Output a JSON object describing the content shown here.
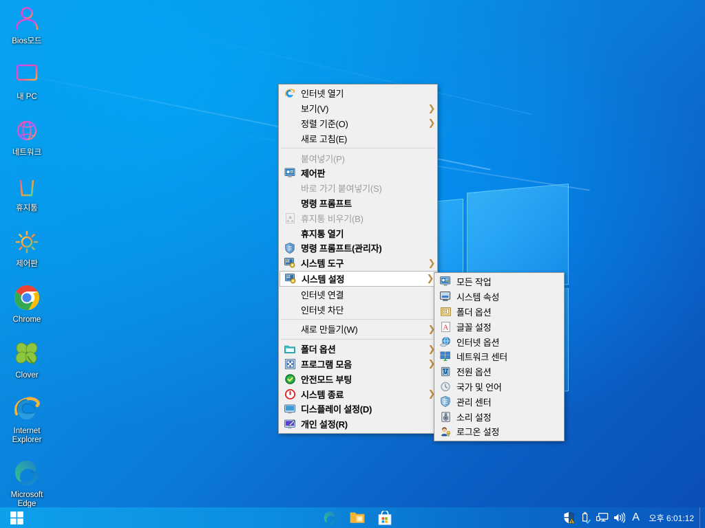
{
  "desktop": {
    "icons": [
      {
        "label": "Bios모드",
        "icon": "person-icon"
      },
      {
        "label": "내 PC",
        "icon": "monitor-icon"
      },
      {
        "label": "네트워크",
        "icon": "globe-icon"
      },
      {
        "label": "휴지통",
        "icon": "recycle-bin-icon"
      },
      {
        "label": "제어판",
        "icon": "gear-icon"
      },
      {
        "label": "Chrome",
        "icon": "chrome-icon"
      },
      {
        "label": "Clover",
        "icon": "clover-icon"
      },
      {
        "label": "Internet Explorer",
        "icon": "internet-explorer-icon"
      },
      {
        "label": "Microsoft Edge",
        "icon": "microsoft-edge-icon"
      }
    ]
  },
  "context_menu": {
    "items": [
      {
        "label": "인터넷 열기",
        "icon": "internet-explorer-icon",
        "bold": false,
        "disabled": false,
        "arrow": false
      },
      {
        "label": "보기(V)",
        "icon": "",
        "bold": false,
        "disabled": false,
        "arrow": true
      },
      {
        "label": "정렬 기준(O)",
        "icon": "",
        "bold": false,
        "disabled": false,
        "arrow": true
      },
      {
        "label": "새로 고침(E)",
        "icon": "",
        "bold": false,
        "disabled": false,
        "arrow": false
      },
      {
        "separator": true
      },
      {
        "label": "붙여넣기(P)",
        "icon": "",
        "bold": false,
        "disabled": true,
        "arrow": false
      },
      {
        "label": "제어판",
        "icon": "control-panel-icon",
        "bold": true,
        "disabled": false,
        "arrow": false
      },
      {
        "label": "바로 가기 붙여넣기(S)",
        "icon": "",
        "bold": false,
        "disabled": true,
        "arrow": false
      },
      {
        "label": "명령 프롬프트",
        "icon": "",
        "bold": true,
        "disabled": false,
        "arrow": false
      },
      {
        "label": "휴지통 비우기(B)",
        "icon": "recycle-bin-icon",
        "bold": false,
        "disabled": true,
        "arrow": false
      },
      {
        "label": "휴지통 열기",
        "icon": "",
        "bold": true,
        "disabled": false,
        "arrow": false
      },
      {
        "label": "명령 프롬프트(관리자)",
        "icon": "shield-icon",
        "bold": true,
        "disabled": false,
        "arrow": false
      },
      {
        "label": "시스템 도구",
        "icon": "system-tools-icon",
        "bold": true,
        "disabled": false,
        "arrow": true
      },
      {
        "label": "시스템 설정",
        "icon": "system-settings-icon",
        "bold": true,
        "disabled": false,
        "arrow": true,
        "selected": true
      },
      {
        "label": "인터넷 연결",
        "icon": "",
        "bold": false,
        "disabled": false,
        "arrow": false
      },
      {
        "label": "인터넷 차단",
        "icon": "",
        "bold": false,
        "disabled": false,
        "arrow": false
      },
      {
        "separator": true
      },
      {
        "label": "새로 만들기(W)",
        "icon": "",
        "bold": false,
        "disabled": false,
        "arrow": true
      },
      {
        "separator": true
      },
      {
        "label": "폴더 옵션",
        "icon": "folder-icon",
        "bold": true,
        "disabled": false,
        "arrow": true
      },
      {
        "label": "프로그램 모음",
        "icon": "programs-icon",
        "bold": true,
        "disabled": false,
        "arrow": true
      },
      {
        "label": "안전모드 부팅",
        "icon": "check-circle-icon",
        "bold": true,
        "disabled": false,
        "arrow": false
      },
      {
        "label": "시스템 종료",
        "icon": "power-icon",
        "bold": true,
        "disabled": false,
        "arrow": true
      },
      {
        "label": "디스플레이 설정(D)",
        "icon": "display-settings-icon",
        "bold": true,
        "disabled": false,
        "arrow": false
      },
      {
        "label": "개인 설정(R)",
        "icon": "personalize-icon",
        "bold": true,
        "disabled": false,
        "arrow": false
      }
    ]
  },
  "sub_menu": {
    "items": [
      {
        "label": "모든 작업",
        "icon": "all-tasks-icon"
      },
      {
        "label": "시스템 속성",
        "icon": "system-properties-icon"
      },
      {
        "label": "폴더 옵션",
        "icon": "folder-options-icon"
      },
      {
        "label": "글꼴 설정",
        "icon": "font-settings-icon"
      },
      {
        "label": "인터넷 옵션",
        "icon": "internet-options-icon"
      },
      {
        "label": "네트워크 센터",
        "icon": "network-center-icon"
      },
      {
        "label": "전원 옵션",
        "icon": "power-options-icon"
      },
      {
        "label": "국가 및 언어",
        "icon": "region-language-icon"
      },
      {
        "label": "관리 센터",
        "icon": "action-center-icon"
      },
      {
        "label": "소리 설정",
        "icon": "sound-settings-icon"
      },
      {
        "label": "로그온 설정",
        "icon": "logon-settings-icon"
      }
    ]
  },
  "taskbar": {
    "start_label": "start-button",
    "pinned": [
      {
        "name": "microsoft-edge-icon",
        "label": "Microsoft Edge"
      },
      {
        "name": "file-explorer-icon",
        "label": "파일 탐색기"
      },
      {
        "name": "microsoft-store-icon",
        "label": "Microsoft Store"
      }
    ],
    "tray": [
      {
        "name": "security-shield-warning-icon",
        "label": "보안 및 유지 관리"
      },
      {
        "name": "safely-remove-hardware-icon",
        "label": "하드웨어 안전하게 제거"
      },
      {
        "name": "network-icon",
        "label": "네트워크"
      },
      {
        "name": "volume-icon",
        "label": "스피커"
      }
    ],
    "language_indicator": "A",
    "clock": "오후 6:01:12"
  },
  "colors": {
    "menu_background": "#f0f0f0",
    "menu_border": "#9a9a9a",
    "selected_item_background": "#ffffff",
    "disabled_text": "#9d9d9d",
    "taskbar_start": "#0fa0ea",
    "taskbar_end": "#0a57bd",
    "desktop_blue": "#0b7ad8",
    "arrow_color": "#c08a3e"
  }
}
